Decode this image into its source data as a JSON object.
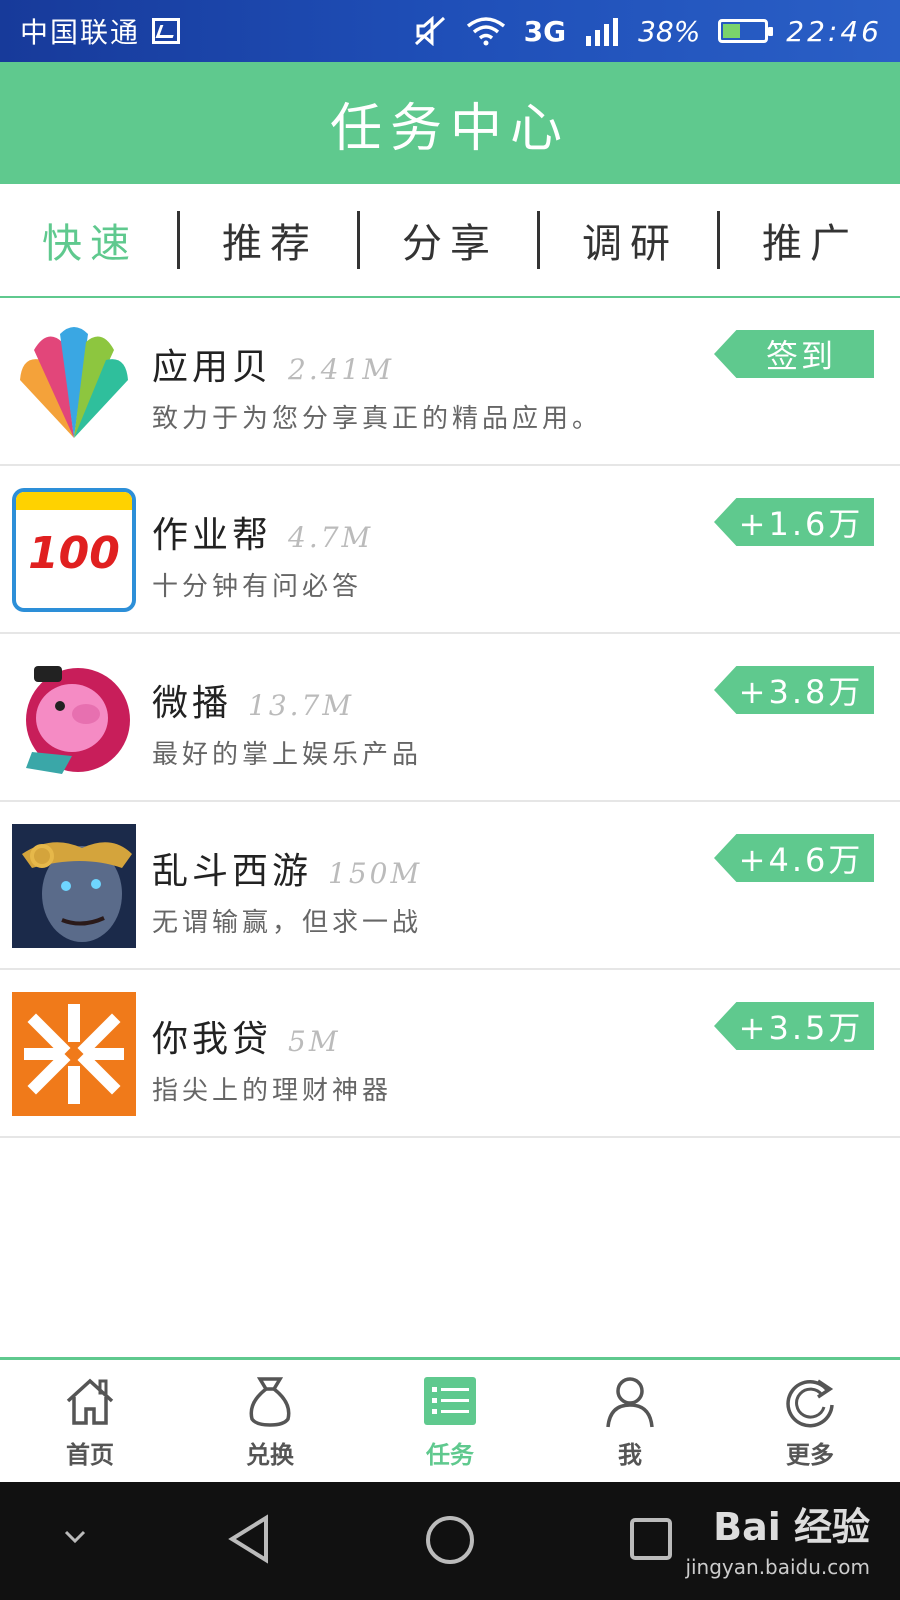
{
  "status": {
    "carrier": "中国联通",
    "network": "3G",
    "battery": "38%",
    "battery_level": 0.38,
    "time": "22:46"
  },
  "header": {
    "title": "任务中心"
  },
  "tabs": [
    {
      "label": "快速",
      "active": true
    },
    {
      "label": "推荐",
      "active": false
    },
    {
      "label": "分享",
      "active": false
    },
    {
      "label": "调研",
      "active": false
    },
    {
      "label": "推广",
      "active": false
    }
  ],
  "apps": [
    {
      "name": "应用贝",
      "size": "2.41M",
      "desc": "致力于为您分享真正的精品应用。",
      "badge": "签到",
      "icon": "yingyongbei-app-icon"
    },
    {
      "name": "作业帮",
      "size": "4.7M",
      "desc": "十分钟有问必答",
      "badge": "+1.6万",
      "icon": "zuoyebang-app-icon",
      "icon_text": "100"
    },
    {
      "name": "微播",
      "size": "13.7M",
      "desc": "最好的掌上娱乐产品",
      "badge": "+3.8万",
      "icon": "weibo-pig-app-icon"
    },
    {
      "name": "乱斗西游",
      "size": "150M",
      "desc": "无谓输赢，但求一战",
      "badge": "+4.6万",
      "icon": "luandouxiyou-app-icon"
    },
    {
      "name": "你我贷",
      "size": "5M",
      "desc": "指尖上的理财神器",
      "badge": "+3.5万",
      "icon": "niwodai-app-icon"
    }
  ],
  "nav": [
    {
      "label": "首页",
      "icon": "home-icon",
      "active": false
    },
    {
      "label": "兑换",
      "icon": "money-bag-icon",
      "active": false
    },
    {
      "label": "任务",
      "icon": "task-list-icon",
      "active": true
    },
    {
      "label": "我",
      "icon": "user-icon",
      "active": false
    },
    {
      "label": "更多",
      "icon": "refresh-icon",
      "active": false
    }
  ],
  "watermark": {
    "brand": "Bai 经验",
    "url": "jingyan.baidu.com"
  },
  "colors": {
    "accent": "#5fc98e",
    "statusbar": "#1f4fb8"
  }
}
